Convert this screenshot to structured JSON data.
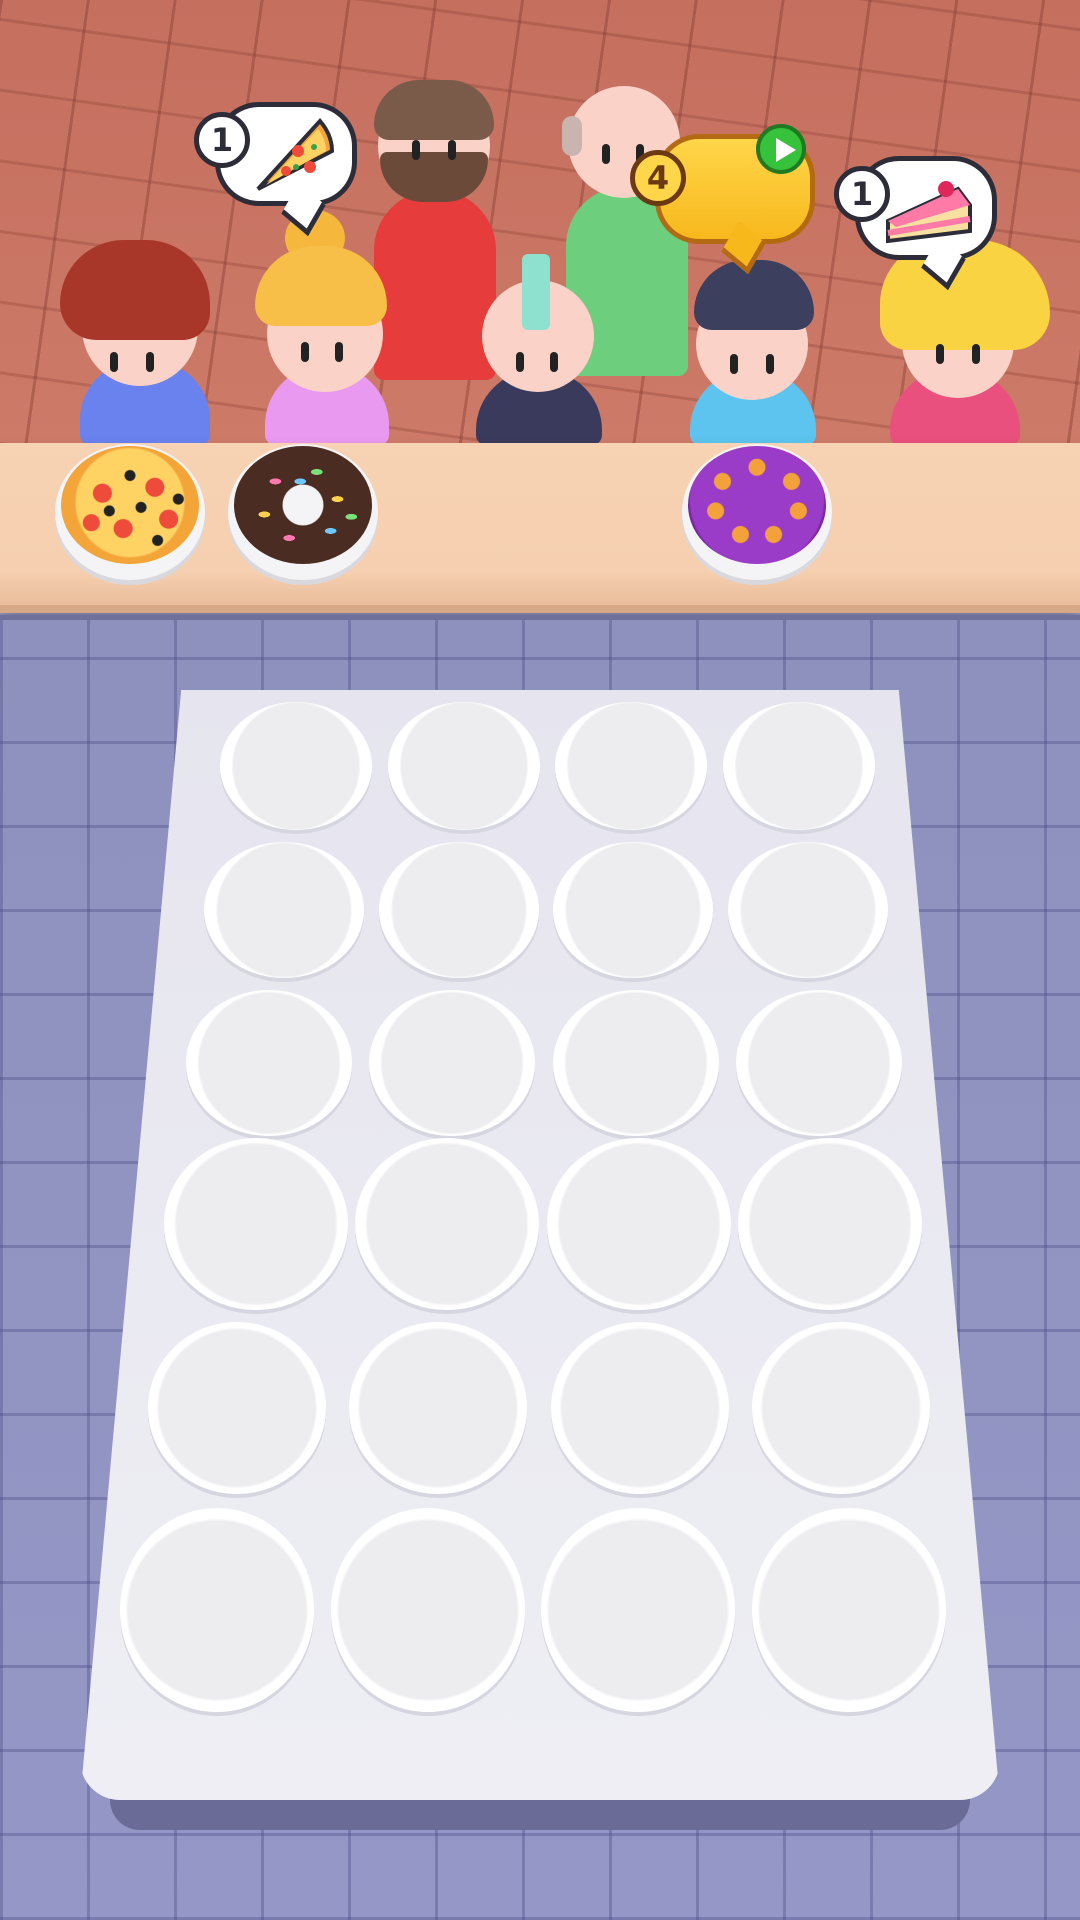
{
  "orders": [
    {
      "count": "1",
      "item_icon": "pizza-slice-icon",
      "style": "white"
    },
    {
      "count": "4",
      "item_icon": "hidden-order",
      "style": "gold",
      "has_play_button": true
    },
    {
      "count": "1",
      "item_icon": "cake-slice-icon",
      "style": "white"
    }
  ],
  "counter_items": [
    {
      "type": "pizza"
    },
    {
      "type": "donut"
    },
    {
      "type": "blueberry-cake"
    }
  ],
  "tray": {
    "rows": 6,
    "columns": 4,
    "empty_plates": 24
  },
  "colors": {
    "floor": "#c56f5f",
    "counter": "#f7d2b3",
    "tiles": "#9597c6",
    "tray": "#e8e7f0",
    "bubble_outline": "#2d2d3a",
    "gold_bubble": "#ffd64a",
    "play_button": "#36c23a"
  }
}
